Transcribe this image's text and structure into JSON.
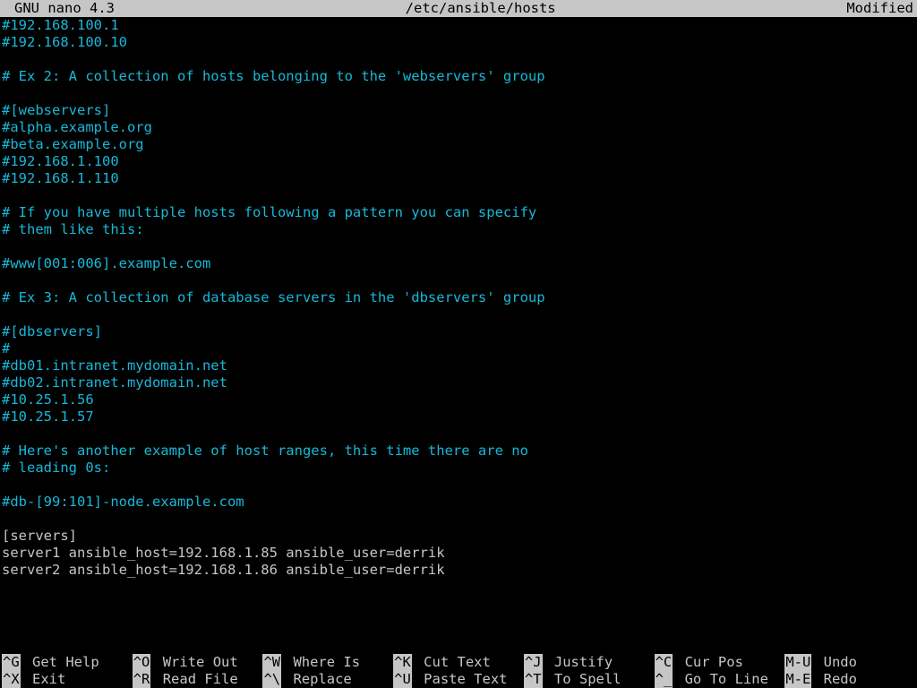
{
  "titlebar": {
    "app": "GNU nano 4.3",
    "file": "/etc/ansible/hosts",
    "status": "Modified"
  },
  "lines": [
    {
      "cls": "comment",
      "text": "#192.168.100.1"
    },
    {
      "cls": "comment",
      "text": "#192.168.100.10"
    },
    {
      "cls": "comment",
      "text": ""
    },
    {
      "cls": "comment",
      "text": "# Ex 2: A collection of hosts belonging to the 'webservers' group"
    },
    {
      "cls": "comment",
      "text": ""
    },
    {
      "cls": "comment",
      "text": "#[webservers]"
    },
    {
      "cls": "comment",
      "text": "#alpha.example.org"
    },
    {
      "cls": "comment",
      "text": "#beta.example.org"
    },
    {
      "cls": "comment",
      "text": "#192.168.1.100"
    },
    {
      "cls": "comment",
      "text": "#192.168.1.110"
    },
    {
      "cls": "comment",
      "text": ""
    },
    {
      "cls": "comment",
      "text": "# If you have multiple hosts following a pattern you can specify"
    },
    {
      "cls": "comment",
      "text": "# them like this:"
    },
    {
      "cls": "comment",
      "text": ""
    },
    {
      "cls": "comment",
      "text": "#www[001:006].example.com"
    },
    {
      "cls": "comment",
      "text": ""
    },
    {
      "cls": "comment",
      "text": "# Ex 3: A collection of database servers in the 'dbservers' group"
    },
    {
      "cls": "comment",
      "text": ""
    },
    {
      "cls": "comment",
      "text": "#[dbservers]"
    },
    {
      "cls": "comment",
      "text": "#"
    },
    {
      "cls": "comment",
      "text": "#db01.intranet.mydomain.net"
    },
    {
      "cls": "comment",
      "text": "#db02.intranet.mydomain.net"
    },
    {
      "cls": "comment",
      "text": "#10.25.1.56"
    },
    {
      "cls": "comment",
      "text": "#10.25.1.57"
    },
    {
      "cls": "comment",
      "text": ""
    },
    {
      "cls": "comment",
      "text": "# Here's another example of host ranges, this time there are no"
    },
    {
      "cls": "comment",
      "text": "# leading 0s:"
    },
    {
      "cls": "comment",
      "text": ""
    },
    {
      "cls": "comment",
      "text": "#db-[99:101]-node.example.com"
    },
    {
      "cls": "plain",
      "text": ""
    },
    {
      "cls": "plain",
      "text": "[servers]"
    },
    {
      "cls": "plain",
      "text": "server1 ansible_host=192.168.1.85 ansible_user=derrik"
    },
    {
      "cls": "plain",
      "text": "server2 ansible_host=192.168.1.86 ansible_user=derrik"
    }
  ],
  "help": {
    "row1": [
      {
        "key": "^G",
        "label": "Get Help"
      },
      {
        "key": "^O",
        "label": "Write Out"
      },
      {
        "key": "^W",
        "label": "Where Is"
      },
      {
        "key": "^K",
        "label": "Cut Text"
      },
      {
        "key": "^J",
        "label": "Justify"
      },
      {
        "key": "^C",
        "label": "Cur Pos"
      },
      {
        "key": "M-U",
        "label": "Undo"
      }
    ],
    "row2": [
      {
        "key": "^X",
        "label": "Exit"
      },
      {
        "key": "^R",
        "label": "Read File"
      },
      {
        "key": "^\\",
        "label": "Replace"
      },
      {
        "key": "^U",
        "label": "Paste Text"
      },
      {
        "key": "^T",
        "label": "To Spell"
      },
      {
        "key": "^_",
        "label": "Go To Line"
      },
      {
        "key": "M-E",
        "label": "Redo"
      }
    ]
  }
}
